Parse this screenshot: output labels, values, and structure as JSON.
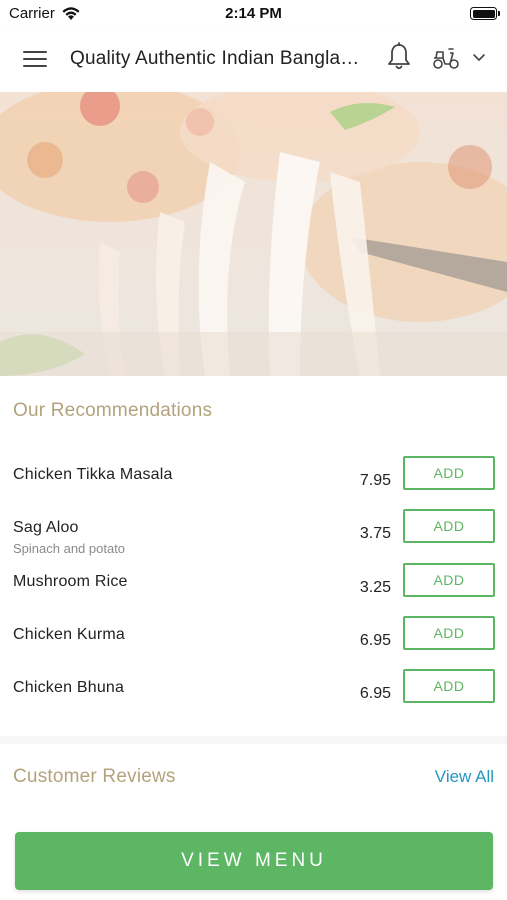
{
  "status_bar": {
    "carrier": "Carrier",
    "time": "2:14 PM"
  },
  "header": {
    "title": "Quality Authentic Indian Bangladeshi Cuisine",
    "icons": [
      "hamburger-menu-icon",
      "bell-icon",
      "scooter-icon",
      "chevron-down-icon"
    ]
  },
  "hero": {
    "image": "cheese-pizza-photo"
  },
  "recommendations": {
    "title": "Our Recommendations",
    "items": [
      {
        "name": "Chicken Tikka Masala",
        "description": "",
        "price": "7.95",
        "button": "ADD"
      },
      {
        "name": "Sag Aloo",
        "description": "Spinach and potato",
        "price": "3.75",
        "button": "ADD"
      },
      {
        "name": "Mushroom Rice",
        "description": "",
        "price": "3.25",
        "button": "ADD"
      },
      {
        "name": "Chicken Kurma",
        "description": "",
        "price": "6.95",
        "button": "ADD"
      },
      {
        "name": "Chicken Bhuna",
        "description": "",
        "price": "6.95",
        "button": "ADD"
      }
    ]
  },
  "reviews": {
    "title": "Customer Reviews",
    "view_all": "View All"
  },
  "footer": {
    "view_menu": "VIEW MENU"
  },
  "colors": {
    "accent_green": "#5db663",
    "section_title": "#b3a37d",
    "link_blue": "#2596be"
  }
}
